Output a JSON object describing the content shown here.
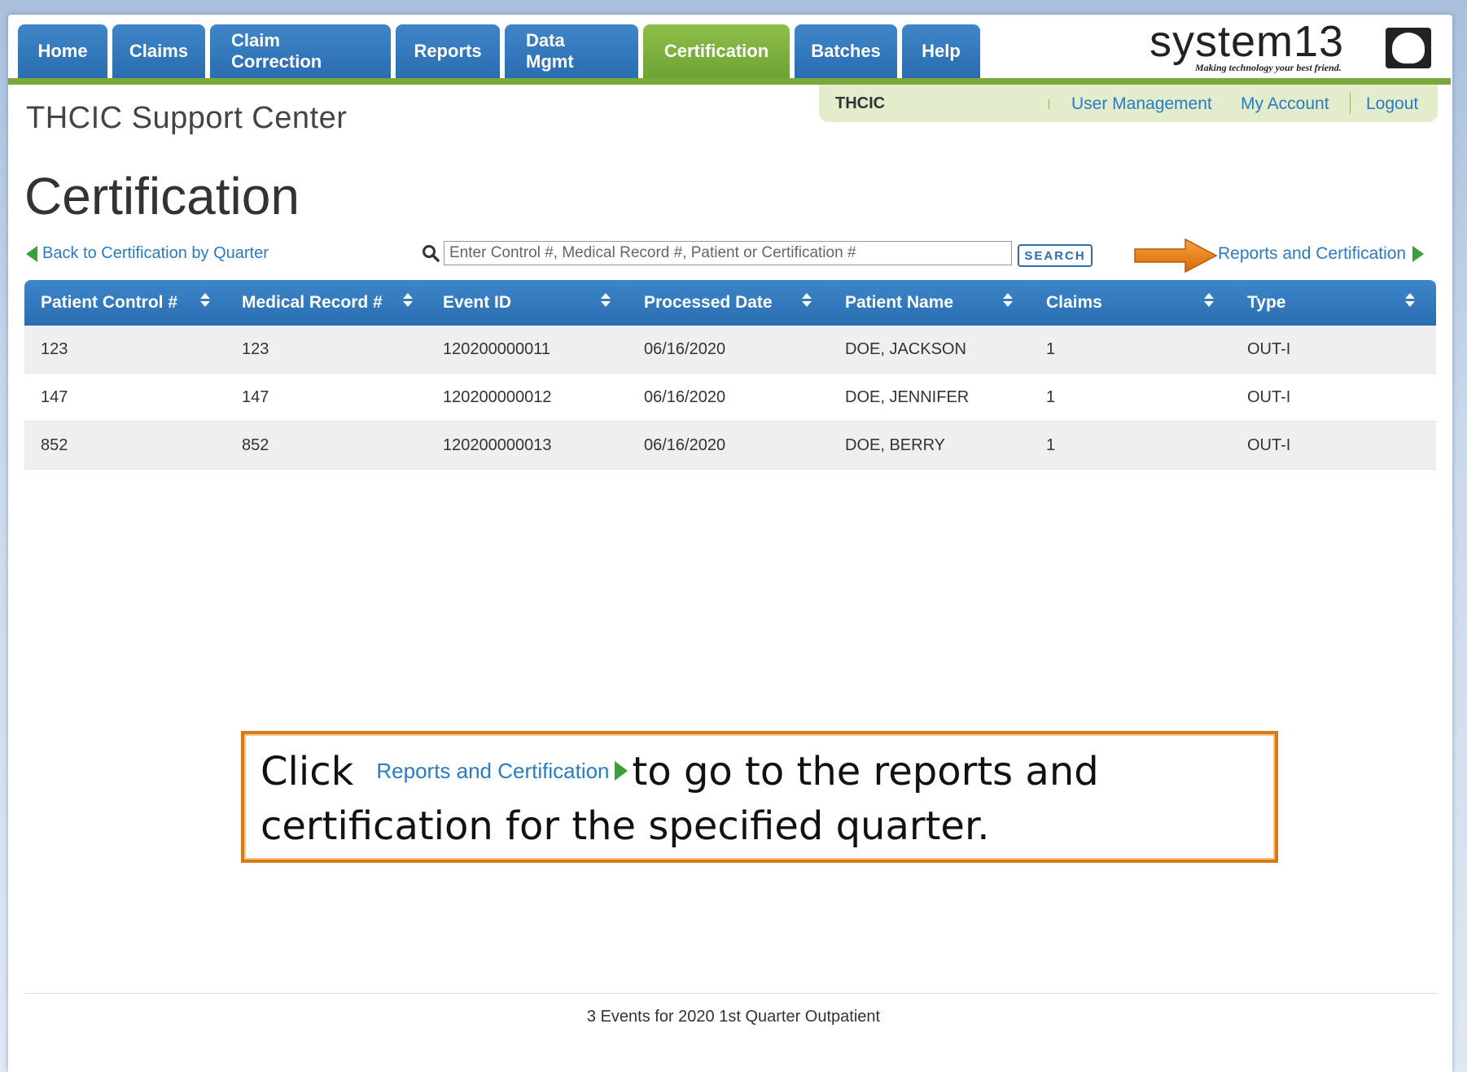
{
  "nav": {
    "tabs": [
      {
        "label": "Home",
        "active": false
      },
      {
        "label": "Claims",
        "active": false
      },
      {
        "label": "Claim Correction",
        "active": false
      },
      {
        "label": "Reports",
        "active": false
      },
      {
        "label": "Data Mgmt",
        "active": false
      },
      {
        "label": "Certification",
        "active": true
      },
      {
        "label": "Batches",
        "active": false
      },
      {
        "label": "Help",
        "active": false
      }
    ]
  },
  "logo": {
    "text": "system13",
    "tagline": "Making technology your best friend."
  },
  "userbar": {
    "org": "THCIC",
    "user_management": "User Management",
    "my_account": "My Account",
    "logout": "Logout"
  },
  "site_title": "THCIC Support Center",
  "page_title": "Certification",
  "toolbar": {
    "back_link": "Back to Certification by Quarter",
    "search_placeholder": "Enter Control #, Medical Record #, Patient or Certification #",
    "search_button": "SEARCH",
    "reports_link": "Reports and Certification"
  },
  "table": {
    "columns": [
      "Patient Control #",
      "Medical Record #",
      "Event ID",
      "Processed Date",
      "Patient Name",
      "Claims",
      "Type"
    ],
    "rows": [
      [
        "123",
        "123",
        "120200000011",
        "06/16/2020",
        "DOE, JACKSON",
        "1",
        "OUT-I"
      ],
      [
        "147",
        "147",
        "120200000012",
        "06/16/2020",
        "DOE, JENNIFER",
        "1",
        "OUT-I"
      ],
      [
        "852",
        "852",
        "120200000013",
        "06/16/2020",
        "DOE, BERRY",
        "1",
        "OUT-I"
      ]
    ]
  },
  "callout": {
    "prefix": "Click",
    "link": "Reports and Certification",
    "suffix": "to go to the reports and certification for the specified quarter."
  },
  "footer": "3 Events for 2020 1st Quarter Outpatient",
  "colors": {
    "nav_blue": "#2a6db0",
    "nav_active_green": "#6ea233",
    "link_blue": "#2a7bc4",
    "callout_border": "#d87a14"
  }
}
